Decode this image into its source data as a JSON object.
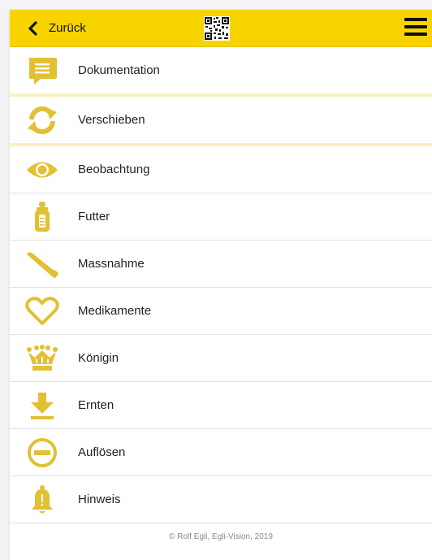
{
  "header": {
    "back_label": "Zurück",
    "accent_color": "#f7d400",
    "icons": [
      "back-arrow-icon",
      "qr-code-icon",
      "hamburger-menu-icon"
    ]
  },
  "menu": {
    "items": [
      {
        "label": "Dokumentation",
        "icon": "document-icon"
      },
      {
        "label": "Verschieben",
        "icon": "refresh-icon"
      },
      {
        "label": "Beobachtung",
        "icon": "eye-icon"
      },
      {
        "label": "Futter",
        "icon": "bottle-icon"
      },
      {
        "label": "Massnahme",
        "icon": "tool-icon"
      },
      {
        "label": "Medikamente",
        "icon": "heart-icon"
      },
      {
        "label": "Königin",
        "icon": "crown-icon"
      },
      {
        "label": "Ernten",
        "icon": "download-icon"
      },
      {
        "label": "Auflösen",
        "icon": "minus-circle-icon"
      },
      {
        "label": "Hinweis",
        "icon": "bell-icon"
      }
    ],
    "icon_color": "#e2c033"
  },
  "footer": {
    "copyright": "© Rolf Egli, Egli-Vision, 2019"
  }
}
